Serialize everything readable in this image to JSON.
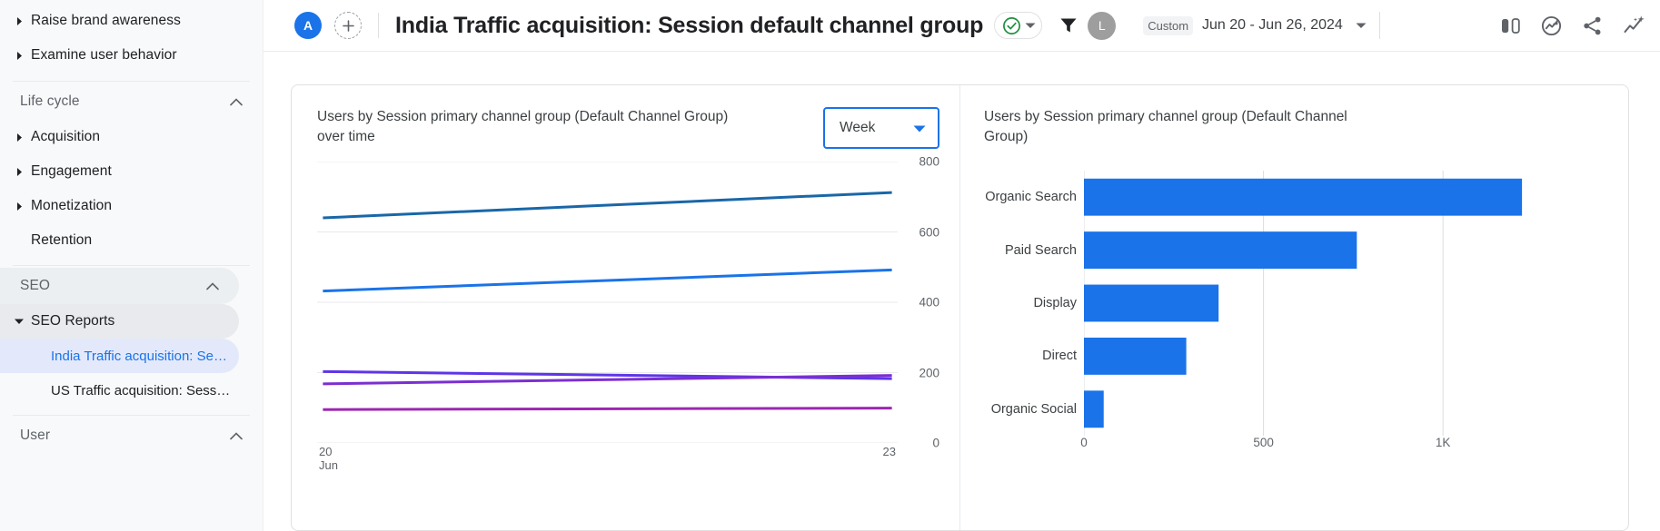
{
  "sidebar": {
    "top_items": [
      {
        "label": "Raise brand awareness",
        "expandable": true
      },
      {
        "label": "Examine user behavior",
        "expandable": true
      }
    ],
    "life_cycle": {
      "title": "Life cycle",
      "items": [
        {
          "label": "Acquisition",
          "expandable": true
        },
        {
          "label": "Engagement",
          "expandable": true
        },
        {
          "label": "Monetization",
          "expandable": true
        },
        {
          "label": "Retention",
          "expandable": false
        }
      ]
    },
    "seo": {
      "title": "SEO",
      "group_label": "SEO Reports",
      "reports": [
        {
          "label": "India Traffic acquisition: Se…",
          "selected": true
        },
        {
          "label": "US Traffic acquisition: Sess…",
          "selected": false
        }
      ]
    },
    "user": {
      "title": "User"
    }
  },
  "topbar": {
    "account_avatar": "A",
    "add_label": "+",
    "page_title": "India Traffic acquisition: Session default channel group",
    "verified_icon": "check-circle-icon",
    "filter_icon": "filter-icon",
    "user_avatar": "L",
    "date_scope": "Custom",
    "date_range": "Jun 20 - Jun 26, 2024",
    "icons": [
      "compare-icon",
      "insights-icon",
      "share-icon",
      "ai-insights-icon"
    ]
  },
  "card": {
    "left": {
      "title": "Users by Session primary channel group (Default Channel Group) over time",
      "granularity": "Week"
    },
    "right": {
      "title": "Users by Session primary channel group (Default Channel Group)"
    }
  },
  "chart_data": [
    {
      "type": "line",
      "title": "Users by Session primary channel group (Default Channel Group) over time",
      "xlabel": "",
      "ylabel": "",
      "x": [
        "20 Jun",
        "23"
      ],
      "x_tick_labels": [
        "20\nJun",
        "23"
      ],
      "ylim": [
        0,
        800
      ],
      "yticks": [
        0,
        200,
        400,
        600,
        800
      ],
      "grid": true,
      "legend": "none",
      "series": [
        {
          "name": "Organic Search",
          "color": "#1967a8",
          "values": [
            640,
            712
          ]
        },
        {
          "name": "Paid Search",
          "color": "#1a73e8",
          "values": [
            432,
            492
          ]
        },
        {
          "name": "Display",
          "color": "#5e35e8",
          "values": [
            203,
            183
          ]
        },
        {
          "name": "Direct",
          "color": "#7b2fd1",
          "values": [
            168,
            192
          ]
        },
        {
          "name": "Organic Social",
          "color": "#9c27b0",
          "values": [
            95,
            99
          ]
        }
      ]
    },
    {
      "type": "bar",
      "orientation": "horizontal",
      "title": "Users by Session primary channel group (Default Channel Group)",
      "xlabel": "",
      "ylabel": "",
      "categories": [
        "Organic Search",
        "Paid Search",
        "Display",
        "Direct",
        "Organic Social"
      ],
      "values": [
        1220,
        760,
        375,
        285,
        55
      ],
      "bar_color": "#1a73e8",
      "xlim": [
        0,
        1450
      ],
      "xticks": [
        0,
        500,
        1000
      ],
      "xtick_labels": [
        "0",
        "500",
        "1K"
      ],
      "grid": true
    }
  ]
}
